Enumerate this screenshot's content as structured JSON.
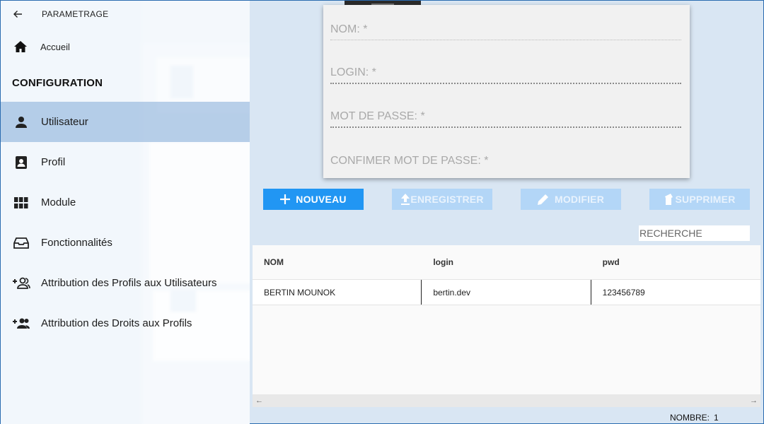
{
  "drawer": {
    "title": "PARAMETRAGE",
    "home_label": "Accueil",
    "section_title": "CONFIGURATION",
    "items": [
      {
        "label": "Utilisateur",
        "icon": "user-icon",
        "selected": true
      },
      {
        "label": "Profil",
        "icon": "profile-card-icon",
        "selected": false
      },
      {
        "label": "Module",
        "icon": "grid-modules-icon",
        "selected": false
      },
      {
        "label": "Fonctionnalités",
        "icon": "features-icon",
        "selected": false
      },
      {
        "label": "Attribution des Profils aux Utilisateurs",
        "icon": "add-user-group-icon",
        "selected": false
      },
      {
        "label": "Attribution des Droits aux Profils",
        "icon": "add-people-icon",
        "selected": false
      }
    ]
  },
  "form": {
    "nom_placeholder": "NOM: *",
    "login_placeholder": "LOGIN: *",
    "password_placeholder": "MOT DE PASSE: *",
    "confirm_placeholder": "CONFIMER MOT DE PASSE: *"
  },
  "toolbar": {
    "new_label": "NOUVEAU",
    "save_label": "ENREGISTRER",
    "edit_label": "MODIFIER",
    "delete_label": "SUPPRIMER"
  },
  "search": {
    "placeholder": "RECHERCHE"
  },
  "table": {
    "columns": [
      "NOM",
      "login",
      "pwd"
    ],
    "rows": [
      [
        "BERTIN MOUNOK",
        "bertin.dev",
        "123456789"
      ]
    ]
  },
  "footer": {
    "count_label": "NOMBRE:",
    "count_value": "1"
  },
  "colors": {
    "accent": "#2196f3",
    "accent_disabled": "#b3d6f7",
    "selected_nav": "#a9c6e6"
  }
}
